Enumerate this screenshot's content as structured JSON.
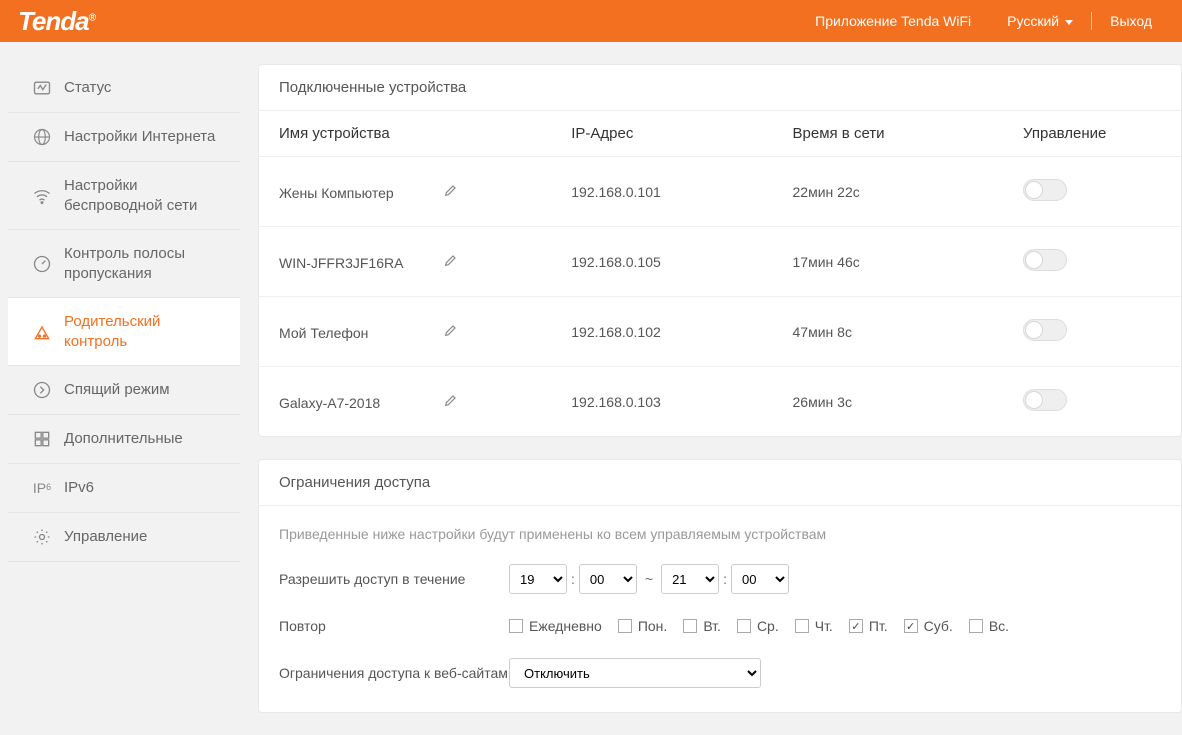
{
  "header": {
    "brand": "Tenda",
    "app_link": "Приложение Tenda WiFi",
    "language": "Русский",
    "logout": "Выход"
  },
  "sidebar": {
    "items": [
      {
        "label": "Статус"
      },
      {
        "label": "Настройки Интернета"
      },
      {
        "label": "Настройки беспроводной сети"
      },
      {
        "label": "Контроль полосы пропускания"
      },
      {
        "label": "Родительский контроль"
      },
      {
        "label": "Спящий режим"
      },
      {
        "label": "Дополнительные"
      },
      {
        "label": "IPv6"
      },
      {
        "label": "Управление"
      }
    ]
  },
  "devices": {
    "title": "Подключенные устройства",
    "columns": {
      "name": "Имя устройства",
      "ip": "IP-Адрес",
      "uptime": "Время в сети",
      "manage": "Управление"
    },
    "rows": [
      {
        "name": "Жены Компьютер",
        "ip": "192.168.0.101",
        "uptime": "22мин 22с"
      },
      {
        "name": "WIN-JFFR3JF16RA",
        "ip": "192.168.0.105",
        "uptime": "17мин 46с"
      },
      {
        "name": "Мой Телефон",
        "ip": "192.168.0.102",
        "uptime": "47мин 8с"
      },
      {
        "name": "Galaxy-A7-2018",
        "ip": "192.168.0.103",
        "uptime": "26мин 3с"
      }
    ]
  },
  "access": {
    "title": "Ограничения доступа",
    "note": "Приведенные ниже настройки будут применены ко всем управляемым устройствам",
    "allow_label": "Разрешить доступ в течение",
    "time_from_h": "19",
    "time_from_m": "00",
    "time_to_h": "21",
    "time_to_m": "00",
    "repeat_label": "Повтор",
    "days": [
      {
        "label": "Ежедневно",
        "checked": false
      },
      {
        "label": "Пон.",
        "checked": false
      },
      {
        "label": "Вт.",
        "checked": false
      },
      {
        "label": "Ср.",
        "checked": false
      },
      {
        "label": "Чт.",
        "checked": false
      },
      {
        "label": "Пт.",
        "checked": true
      },
      {
        "label": "Суб.",
        "checked": true
      },
      {
        "label": "Вс.",
        "checked": false
      }
    ],
    "web_restrict_label": "Ограничения доступа к веб-сайтам",
    "web_restrict_value": "Отключить"
  }
}
